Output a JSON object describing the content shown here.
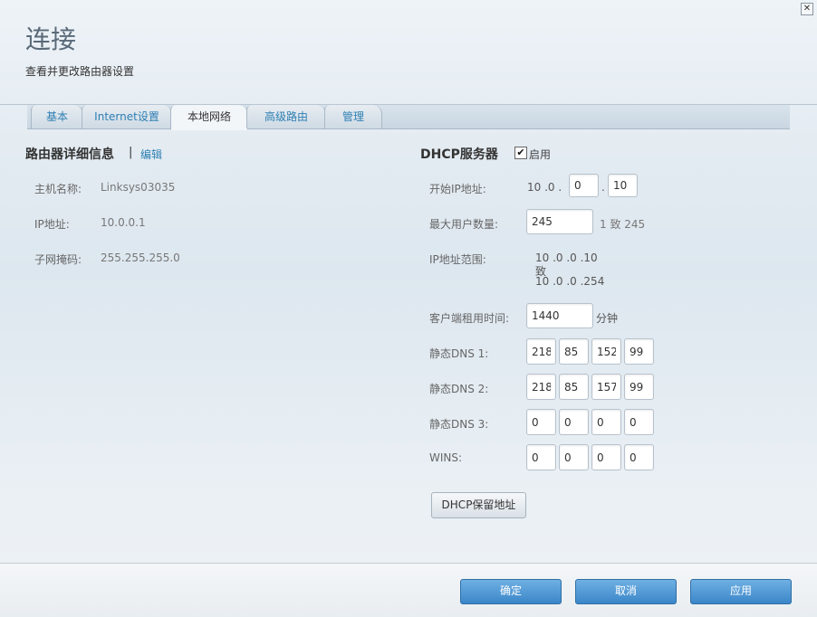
{
  "window": {
    "close_symbol": "✕"
  },
  "header": {
    "title": "连接",
    "subtitle": "查看并更改路由器设置"
  },
  "tabs": [
    {
      "label": "基本",
      "active": false
    },
    {
      "label": "Internet设置",
      "active": false
    },
    {
      "label": "本地网络",
      "active": true
    },
    {
      "label": "高级路由",
      "active": false
    },
    {
      "label": "管理",
      "active": false
    }
  ],
  "router": {
    "heading": "路由器详细信息",
    "separator": "|",
    "edit_link": "编辑",
    "hostname_label": "主机名称:",
    "hostname_value": "Linksys03035",
    "ip_label": "IP地址:",
    "ip_value": "10.0.0.1",
    "subnet_label": "子网掩码:",
    "subnet_value": "255.255.255.0"
  },
  "dhcp": {
    "heading": "DHCP服务器",
    "enable_label": "启用",
    "enabled": true,
    "start_ip_label": "开始IP地址:",
    "start_ip_prefix": "10 .0 .",
    "start_ip_o3": "0",
    "start_ip_dot": ".",
    "start_ip_o4": "10",
    "max_users_label": "最大用户数量:",
    "max_users_value": "245",
    "max_users_range": "1 致 245",
    "range_label": "IP地址范围:",
    "range_start": "10 .0 .0 .10",
    "range_to": "致",
    "range_end": "10 .0 .0 .254",
    "lease_label": "客户端租用时间:",
    "lease_value": "1440",
    "lease_unit": "分钟",
    "dns1_label": "静态DNS 1:",
    "dns1": [
      "218",
      "85",
      "152",
      "99"
    ],
    "dns2_label": "静态DNS 2:",
    "dns2": [
      "218",
      "85",
      "157",
      "99"
    ],
    "dns3_label": "静态DNS 3:",
    "dns3": [
      "0",
      "0",
      "0",
      "0"
    ],
    "wins_label": "WINS:",
    "wins": [
      "0",
      "0",
      "0",
      "0"
    ],
    "reserve_button": "DHCP保留地址"
  },
  "footer": {
    "ok": "确定",
    "cancel": "取消",
    "apply": "应用"
  }
}
